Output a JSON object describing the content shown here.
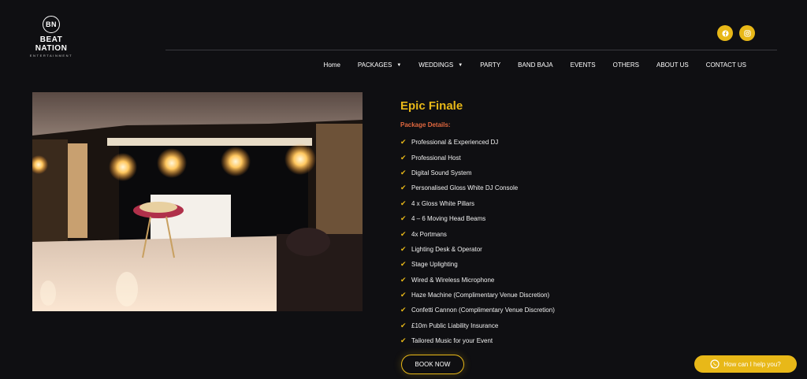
{
  "brand": {
    "logo_initials": "BN",
    "name": "BEAT NATION",
    "tagline": "ENTERTAINMENT"
  },
  "social": [
    {
      "icon": "facebook-icon"
    },
    {
      "icon": "instagram-icon"
    }
  ],
  "nav": [
    {
      "label": "Home",
      "dropdown": false
    },
    {
      "label": "PACKAGES",
      "dropdown": true
    },
    {
      "label": "WEDDINGS",
      "dropdown": true
    },
    {
      "label": "PARTY",
      "dropdown": false
    },
    {
      "label": "BAND BAJA",
      "dropdown": false
    },
    {
      "label": "EVENTS",
      "dropdown": false
    },
    {
      "label": "OTHERS",
      "dropdown": false
    },
    {
      "label": "ABOUT US",
      "dropdown": false
    },
    {
      "label": "CONTACT US",
      "dropdown": false
    }
  ],
  "package": {
    "title": "Epic Finale",
    "details_label": "Package Details:",
    "features": [
      "Professional & Experienced DJ",
      "Professional Host",
      "Digital Sound System",
      "Personalised Gloss White DJ Console",
      "4 x Gloss White Pillars",
      "4 – 6 Moving Head Beams",
      "4x Portmans",
      "Lighting Desk & Operator",
      "Stage Uplighting",
      "Wired & Wireless Microphone",
      "Haze Machine (Complimentary Venue Discretion)",
      "Confetti Cannon (Complimentary Venue Discretion)",
      "£10m Public Liability Insurance",
      "Tailored Music for your Event"
    ],
    "cta": "BOOK NOW"
  },
  "chat": {
    "label": "How can I help you?"
  },
  "colors": {
    "accent": "#e8b818",
    "subtitle": "#e2683f",
    "background": "#0f0f12"
  }
}
